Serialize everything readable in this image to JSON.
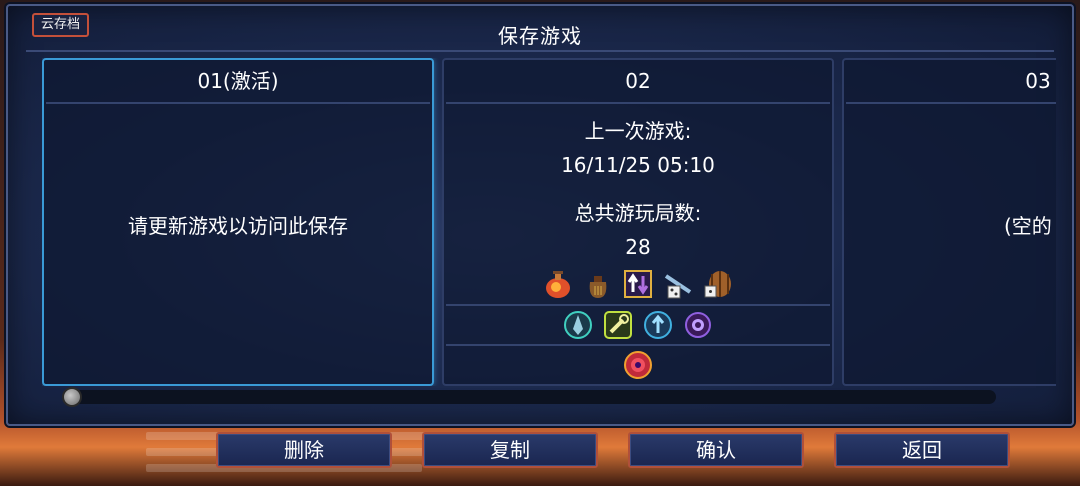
{
  "header": {
    "cloud_label": "云存档",
    "title": "保存游戏"
  },
  "slots": [
    {
      "number": "01(激活)",
      "active": true,
      "message": "请更新游戏以访问此保存"
    },
    {
      "number": "02",
      "active": false,
      "last_played_label": "上一次游戏:",
      "last_played_value": "16/11/25 05:10",
      "total_runs_label": "总共游玩局数:",
      "total_runs_value": "28",
      "icon_rows": [
        [
          "potion-icon",
          "money-bag-icon",
          "swap-arrows-icon",
          "dice-scroll-icon",
          "barrel-dice-icon"
        ],
        [
          "rune-crystal-icon",
          "wrench-icon",
          "arrow-up-icon",
          "eye-portal-icon"
        ],
        [
          "target-eye-icon"
        ]
      ]
    },
    {
      "number": "03",
      "active": false,
      "message": "(空的"
    }
  ],
  "scrollbar": {
    "position": 0
  },
  "buttons": {
    "delete": "删除",
    "copy": "复制",
    "confirm": "确认",
    "back": "返回"
  },
  "colors": {
    "active_border": "#3a9ad6",
    "button_border": "#b0503a",
    "panel": "#1c2a4e"
  }
}
